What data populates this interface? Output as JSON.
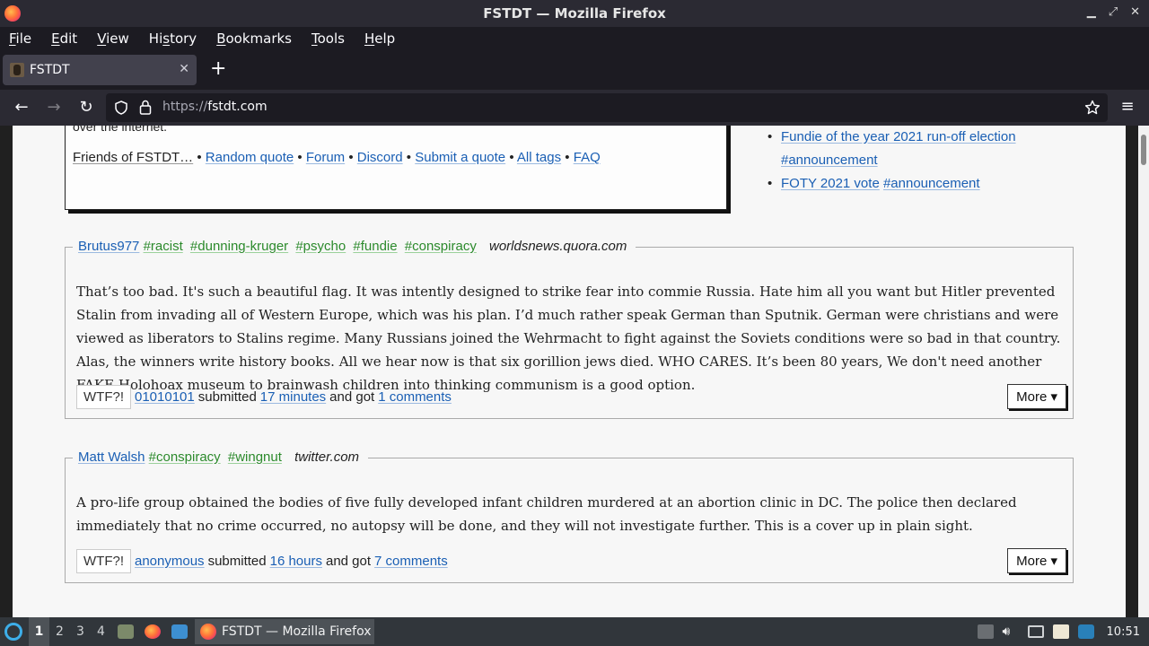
{
  "window": {
    "title": "FSTDT — Mozilla Firefox"
  },
  "menu": [
    "File",
    "Edit",
    "View",
    "History",
    "Bookmarks",
    "Tools",
    "Help"
  ],
  "menu_underline": [
    "F",
    "E",
    "V",
    "s",
    "B",
    "T",
    "H"
  ],
  "tab": {
    "title": "FSTDT"
  },
  "urlbar": {
    "scheme": "https://",
    "host": "fstdt.com"
  },
  "infobox": {
    "cut_text": "over the internet.",
    "friends_label": "Friends of FSTDT…",
    "links": [
      "Random quote",
      "Forum",
      "Discord",
      "Submit a quote",
      "All tags",
      "FAQ"
    ],
    "separator": "•"
  },
  "sidebar": {
    "items": [
      {
        "text": "Fundie of the year 2021 run-off election",
        "tag": "#announcement"
      },
      {
        "text": "FOTY 2021 vote",
        "tag": "#announcement"
      }
    ]
  },
  "posts": [
    {
      "author": "Brutus977",
      "tags": [
        "#racist",
        "#dunning-kruger",
        "#psycho",
        "#fundie",
        "#conspiracy"
      ],
      "source": "worldsnews.quora.com",
      "body": "That’s too bad. It's such a beautiful flag. It was intently designed to strike fear into commie Russia. Hate him all you want but Hitler prevented Stalin from invading all of Western Europe, which was his plan. I’d much rather speak German than Sputnik. German were christians and were viewed as liberators to Stalins regime. Many Russians joined the Wehrmacht to fight against the Soviets conditions were so bad in that country. Alas, the winners write history books. All we hear now is that six gorillion jews died. WHO CARES. It’s been 80 years, We don't need another FAKE Holohoax museum to brainwash children into thinking communism is a good option.",
      "wtf": "WTF?!",
      "submitter": "01010101",
      "submitted_word": "submitted",
      "time": "17 minutes",
      "got_word": "and got",
      "comments": "1 comments",
      "more": "More ▾"
    },
    {
      "author": "Matt Walsh",
      "tags": [
        "#conspiracy",
        "#wingnut"
      ],
      "source": "twitter.com",
      "body": "A pro-life group obtained the bodies of five fully developed infant children murdered at an abortion clinic in DC. The police then declared immediately that no crime occurred, no autopsy will be done, and they will not investigate further. This is a cover up in plain sight.",
      "wtf": "WTF?!",
      "submitter": "anonymous",
      "submitted_word": "submitted",
      "time": "16 hours",
      "got_word": "and got",
      "comments": "7 comments",
      "more": "More ▾"
    }
  ],
  "taskbar": {
    "desktops": [
      "1",
      "2",
      "3",
      "4"
    ],
    "active_window": "FSTDT — Mozilla Firefox",
    "clock": "10:51"
  }
}
